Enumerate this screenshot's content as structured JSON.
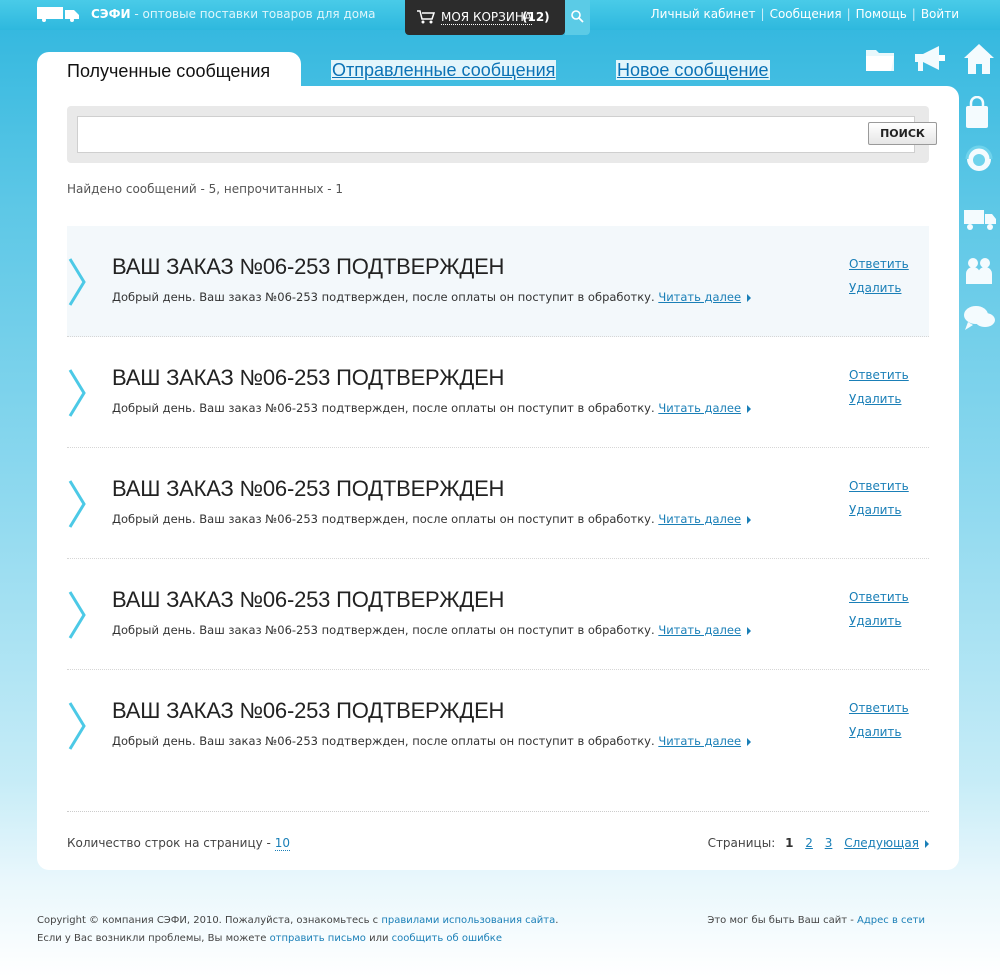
{
  "header": {
    "brand_name": "СЭФИ",
    "brand_tagline": "- оптовые поставки товаров для дома",
    "cart_label": "МОЯ КОРЗИНА",
    "cart_count": "(12)",
    "nav": [
      "Личный кабинет",
      "Сообщения",
      "Помощь",
      "Войти"
    ]
  },
  "tabs": {
    "active": "Полученные сообщения",
    "sent": "Отправленные сообщения",
    "new": "Новое сообщение"
  },
  "search": {
    "value": "",
    "button_label": "ПОИСК"
  },
  "found_text": "Найдено сообщений - 5, непрочитанных - 1",
  "messages": [
    {
      "title": "ВАШ ЗАКАЗ №06-253 ПОДТВЕРЖДЕН",
      "preview": "Добрый день. Ваш заказ №06-253 подтвержден, после оплаты он поступит в обработку.",
      "read_more": "Читать далее",
      "reply": "Ответить",
      "delete": "Удалить",
      "unread": true
    },
    {
      "title": "ВАШ ЗАКАЗ №06-253 ПОДТВЕРЖДЕН",
      "preview": "Добрый день. Ваш заказ №06-253 подтвержден, после оплаты он поступит в обработку.",
      "read_more": "Читать далее",
      "reply": "Ответить",
      "delete": "Удалить",
      "unread": false
    },
    {
      "title": "ВАШ ЗАКАЗ №06-253 ПОДТВЕРЖДЕН",
      "preview": "Добрый день. Ваш заказ №06-253 подтвержден, после оплаты он поступит в обработку.",
      "read_more": "Читать далее",
      "reply": "Ответить",
      "delete": "Удалить",
      "unread": false
    },
    {
      "title": "ВАШ ЗАКАЗ №06-253 ПОДТВЕРЖДЕН",
      "preview": "Добрый день. Ваш заказ №06-253 подтвержден, после оплаты он поступит в обработку.",
      "read_more": "Читать далее",
      "reply": "Ответить",
      "delete": "Удалить",
      "unread": false
    },
    {
      "title": "ВАШ ЗАКАЗ №06-253 ПОДТВЕРЖДЕН",
      "preview": "Добрый день. Ваш заказ №06-253 подтвержден, после оплаты он поступит в обработку.",
      "read_more": "Читать далее",
      "reply": "Ответить",
      "delete": "Удалить",
      "unread": false
    }
  ],
  "pagination": {
    "rows_label": "Количество строк на страницу -",
    "rows_value": "10",
    "pages_label": "Страницы:",
    "current": "1",
    "pages": [
      "2",
      "3"
    ],
    "next_label": "Следующая"
  },
  "footer": {
    "copyright_1": "Copyright © компания СЭФИ, 2010. Пожалуйста, ознакомьтесь с",
    "rules_link": "правилами использования сайта",
    "copyright_2": ". Если у Вас возникли проблемы, Вы можете",
    "send_link": "отправить письмо",
    "or": "или",
    "report_link": "сообщить об ошибке",
    "right_text": "Это мог бы быть Ваш сайт -",
    "right_link": "Адрес в сети"
  },
  "colors": {
    "accent": "#1a7fb7",
    "chevron": "#4cc9e6",
    "header": "#2eb8de"
  },
  "icons": [
    "truck-icon",
    "cart-icon",
    "search-icon",
    "folder-icon",
    "megaphone-icon",
    "home-icon",
    "bag-icon",
    "support-icon",
    "delivery-truck-icon",
    "people-icon",
    "chat-icon",
    "chevron-right-icon"
  ]
}
